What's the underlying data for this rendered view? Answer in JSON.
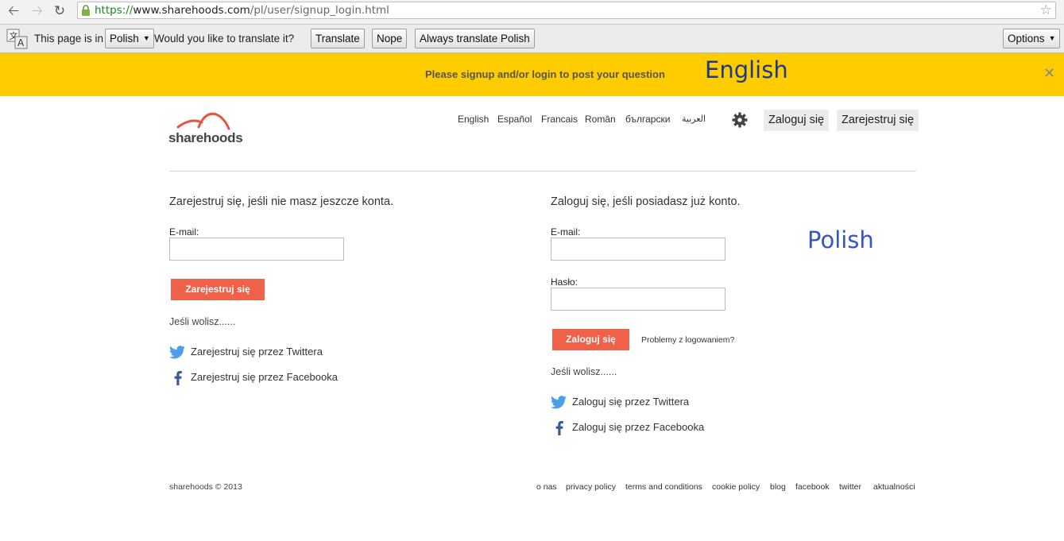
{
  "browser": {
    "url_scheme": "https://",
    "url_domain": "www.sharehoods.com",
    "url_path": "/pl/user/signup_login.html"
  },
  "translate_bar": {
    "prefix": "This page is in",
    "language": "Polish",
    "question": "Would you like to translate it?",
    "translate_label": "Translate",
    "nope_label": "Nope",
    "always_label": "Always translate Polish",
    "options_label": "Options"
  },
  "notice": {
    "message": "Please signup and/or login to post your question"
  },
  "overlays": {
    "english": "English",
    "polish": "Polish"
  },
  "header": {
    "logo_text": "sharehoods",
    "languages": [
      "English",
      "Español",
      "Francais",
      "Român",
      "български",
      "العربية"
    ],
    "login_label": "Zaloguj się",
    "signup_label": "Zarejestruj się"
  },
  "signup": {
    "heading": "Zarejestruj się, jeśli nie masz jeszcze konta.",
    "email_label": "E-mail:",
    "submit_label": "Zarejestruj się",
    "or_text": "Jeśli wolisz......",
    "twitter_label": "Zarejestruj się przez Twittera",
    "facebook_label": "Zarejestruj się przez Facebooka"
  },
  "login": {
    "heading": "Zaloguj się, jeśli posiadasz już konto.",
    "email_label": "E-mail:",
    "password_label": "Hasło:",
    "submit_label": "Zaloguj się",
    "problem_label": "Problemy z logowaniem?",
    "or_text": "Jeśli wolisz......",
    "twitter_label": "Zaloguj się przez Twittera",
    "facebook_label": "Zaloguj się przez Facebooka"
  },
  "footer": {
    "copyright": "sharehoods © 2013",
    "links": [
      "o nas",
      "privacy policy",
      "terms and conditions",
      "cookie policy",
      "blog",
      "facebook",
      "twitter",
      "aktualności"
    ]
  },
  "colors": {
    "notice_bg": "#ffcc00",
    "accent_red": "#ef6149",
    "twitter_blue": "#4a9fe8",
    "facebook_blue": "#3b5998"
  }
}
